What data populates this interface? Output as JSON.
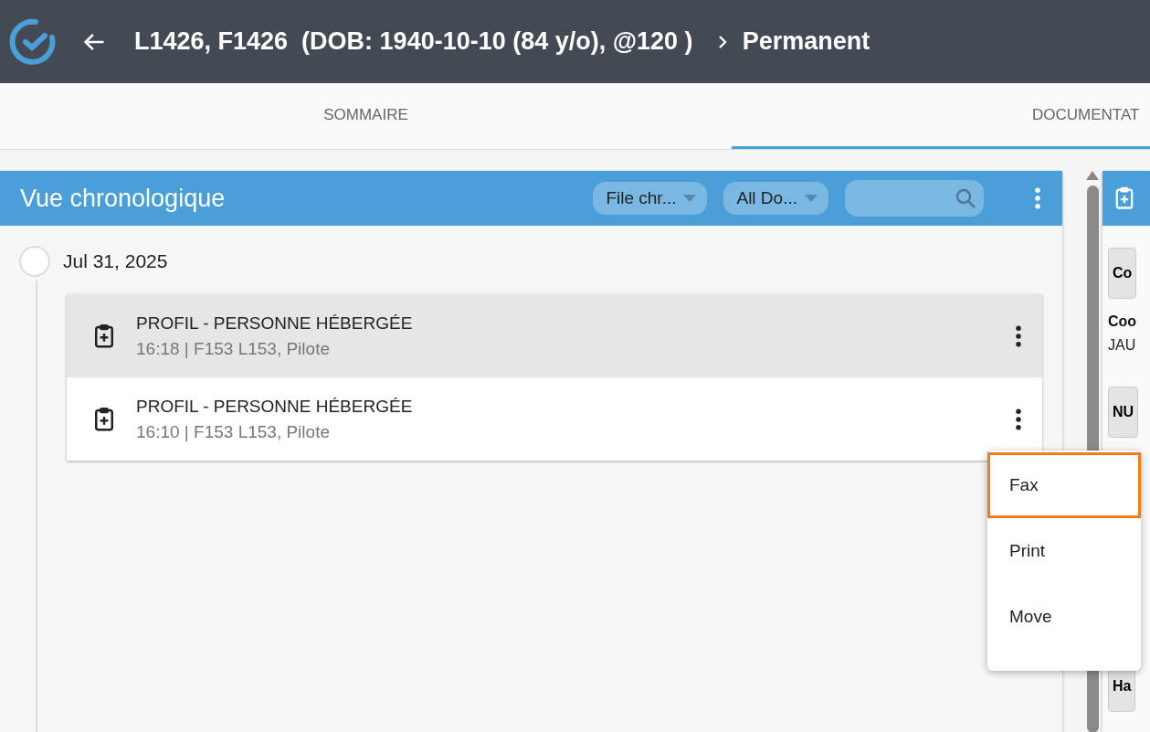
{
  "header": {
    "title": "L1426, F1426  (DOB: 1940-10-10 (84 y/o), @120 )",
    "breadcrumb": "Permanent"
  },
  "tabs": [
    {
      "label": "SOMMAIRE",
      "selected": false
    },
    {
      "label": "DOCUMENTAT",
      "selected": true
    }
  ],
  "timeline_panel": {
    "title": "Vue chronologique",
    "filters": [
      "File chr...",
      "All Do..."
    ],
    "groups": [
      {
        "date": "Jul 31, 2025",
        "entries": [
          {
            "title": "PROFIL - PERSONNE HÉBERGÉE",
            "meta": "16:18 | F153 L153, Pilote",
            "selected": true
          },
          {
            "title": "PROFIL - PERSONNE HÉBERGÉE",
            "meta": "16:10 | F153 L153, Pilote",
            "selected": false
          }
        ]
      }
    ]
  },
  "context_menu": {
    "items": [
      {
        "label": "Fax",
        "selected": true
      },
      {
        "label": "Print",
        "selected": false
      },
      {
        "label": "Move",
        "selected": false
      }
    ]
  },
  "side_panel": {
    "items": [
      {
        "kind": "button",
        "text": "Co"
      },
      {
        "kind": "label",
        "text": "Coo"
      },
      {
        "kind": "value",
        "text": "JAU"
      },
      {
        "kind": "button",
        "text": "NU"
      },
      {
        "kind": "button",
        "text": "Ha"
      }
    ]
  }
}
